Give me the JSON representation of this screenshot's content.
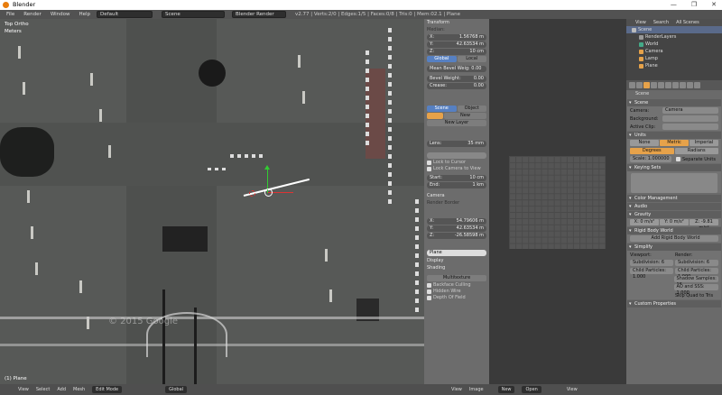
{
  "window": {
    "title": "Blender",
    "controls": [
      "—",
      "❐",
      "✕"
    ]
  },
  "topbar": {
    "menus": [
      "File",
      "Render",
      "Window",
      "Help"
    ],
    "layout": "Default",
    "scene": "Scene",
    "engine": "Blender Render",
    "stats": "v2.77 | Verts:2/0 | Edges:1/5 | Faces:0/8 | Tris:0 | Mem:02.1 | Plane"
  },
  "viewport": {
    "view_label": "Top Ortho",
    "unit_label": "Meters",
    "object_label": "(1) Plane",
    "watermark": "© 2015 Google"
  },
  "npanel": {
    "header": "Transform",
    "median": "Median:",
    "x": {
      "label": "X:",
      "value": "1.56768 m"
    },
    "y": {
      "label": "Y:",
      "value": "42.63534 m"
    },
    "z": {
      "label": "Z:",
      "value": "10 cm"
    },
    "global": "Global",
    "local": "Local",
    "mean_bevel": "Mean Bevel Weig: 0.00",
    "bevel_weight": {
      "label": "Bevel Weight:",
      "value": "0.00"
    },
    "crease": {
      "label": "Crease:",
      "value": "0.00"
    },
    "scene_btn": "Scene",
    "object_btn": "Object",
    "new_btn": "New",
    "new_layer": "New Layer",
    "lens": {
      "label": "Lens:",
      "value": "35 mm"
    },
    "lock_cursor": "Lock to Cursor",
    "lock_camera": "Lock Camera to View",
    "start": {
      "label": "Start:",
      "value": "10 cm"
    },
    "end": {
      "label": "End:",
      "value": "1 km"
    },
    "camera_label": "Camera",
    "render_border": "Render Border",
    "cx": {
      "label": "X:",
      "value": "54.79606 m"
    },
    "cy": {
      "label": "Y:",
      "value": "42.63534 m"
    },
    "cz": {
      "label": "Z:",
      "value": "-26.58598 m"
    },
    "plane": "Plane",
    "display": "Display",
    "shading": "Shading",
    "matcap": "Multitexture",
    "backface": "Backface Culling",
    "hidden_wire": "Hidden Wire",
    "depth": "Depth Of Field"
  },
  "outliner": {
    "tabs": [
      "View",
      "Search",
      "All Scenes"
    ],
    "items": [
      "Scene",
      "RenderLayers",
      "World",
      "Camera",
      "Lamp",
      "Plane"
    ]
  },
  "properties": {
    "crumb": "Scene",
    "scene_panel": "Scene",
    "camera": {
      "label": "Camera:",
      "value": "Camera"
    },
    "background": {
      "label": "Background:",
      "value": ""
    },
    "active_clip": {
      "label": "Active Clip:",
      "value": ""
    },
    "units_panel": "Units",
    "unit_sys": [
      "None",
      "Metric",
      "Imperial"
    ],
    "rotation": [
      "Degrees",
      "Radians"
    ],
    "scale": "Scale: 1.000000",
    "separate": "Separate Units",
    "keying_panel": "Keying Sets",
    "color_mgmt": "Color Management",
    "audio": "Audio",
    "gravity": "Gravity",
    "gx": "X: 0 m/s²",
    "gy": "Y: 0 m/s²",
    "gz": "Z: -9.81 m/s²",
    "rigid": "Rigid Body World",
    "add_rigid": "Add Rigid Body World",
    "simplify": "Simplify",
    "viewport_lbl": "Viewport:",
    "render_lbl": "Render:",
    "subdiv": "Subdivision: 6",
    "child": "Child Particles: 1.000",
    "shadow": "Shadow Samples: 16",
    "ao": "AO and SSS: 1.000",
    "skip": "Skip Quad to Tris",
    "custom": "Custom Properties"
  },
  "bottombar": {
    "items": [
      "View",
      "Select",
      "Add",
      "Mesh"
    ],
    "mode": "Edit Mode",
    "orient": "Global",
    "uv_items": [
      "View",
      "Image"
    ],
    "new": "New",
    "open": "Open",
    "view_right": "View"
  }
}
